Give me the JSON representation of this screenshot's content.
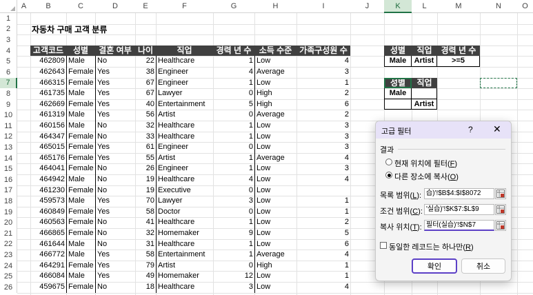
{
  "columns": [
    "A",
    "B",
    "C",
    "D",
    "E",
    "F",
    "G",
    "H",
    "I",
    "J",
    "K",
    "L",
    "M",
    "N",
    "O"
  ],
  "rows": [
    "1",
    "2",
    "3",
    "4",
    "5",
    "6",
    "7",
    "8",
    "9",
    "10",
    "11",
    "12",
    "13",
    "14",
    "15",
    "16",
    "17",
    "18",
    "19",
    "20",
    "21",
    "22",
    "23",
    "24",
    "25",
    "26"
  ],
  "title": "자동차 구매 고객 분류",
  "table": {
    "headers": [
      "고객코드",
      "성별",
      "결혼 여부",
      "나이",
      "직업",
      "경력 년 수",
      "소득 수준",
      "가족구성원 수"
    ],
    "rows": [
      [
        "462809",
        "Male",
        "No",
        "22",
        "Healthcare",
        "1",
        "Low",
        "4"
      ],
      [
        "462643",
        "Female",
        "Yes",
        "38",
        "Engineer",
        "4",
        "Average",
        "3"
      ],
      [
        "466315",
        "Female",
        "Yes",
        "67",
        "Engineer",
        "1",
        "Low",
        "1"
      ],
      [
        "461735",
        "Male",
        "Yes",
        "67",
        "Lawyer",
        "0",
        "High",
        "2"
      ],
      [
        "462669",
        "Female",
        "Yes",
        "40",
        "Entertainment",
        "5",
        "High",
        "6"
      ],
      [
        "461319",
        "Male",
        "Yes",
        "56",
        "Artist",
        "0",
        "Average",
        "2"
      ],
      [
        "460156",
        "Male",
        "No",
        "32",
        "Healthcare",
        "1",
        "Low",
        "3"
      ],
      [
        "464347",
        "Female",
        "No",
        "33",
        "Healthcare",
        "1",
        "Low",
        "3"
      ],
      [
        "465015",
        "Female",
        "Yes",
        "61",
        "Engineer",
        "0",
        "Low",
        "3"
      ],
      [
        "465176",
        "Female",
        "Yes",
        "55",
        "Artist",
        "1",
        "Average",
        "4"
      ],
      [
        "464041",
        "Female",
        "No",
        "26",
        "Engineer",
        "1",
        "Low",
        "3"
      ],
      [
        "464942",
        "Male",
        "No",
        "19",
        "Healthcare",
        "4",
        "Low",
        "4"
      ],
      [
        "461230",
        "Female",
        "No",
        "19",
        "Executive",
        "0",
        "Low",
        ""
      ],
      [
        "459573",
        "Male",
        "Yes",
        "70",
        "Lawyer",
        "3",
        "Low",
        "1"
      ],
      [
        "460849",
        "Female",
        "Yes",
        "58",
        "Doctor",
        "0",
        "Low",
        "1"
      ],
      [
        "460563",
        "Female",
        "No",
        "41",
        "Healthcare",
        "1",
        "Low",
        "2"
      ],
      [
        "466865",
        "Female",
        "No",
        "32",
        "Homemaker",
        "9",
        "Low",
        "5"
      ],
      [
        "461644",
        "Male",
        "No",
        "31",
        "Healthcare",
        "1",
        "Low",
        "6"
      ],
      [
        "466772",
        "Male",
        "Yes",
        "58",
        "Entertainment",
        "1",
        "Average",
        "4"
      ],
      [
        "464291",
        "Female",
        "Yes",
        "79",
        "Artist",
        "0",
        "High",
        "1"
      ],
      [
        "466084",
        "Male",
        "Yes",
        "49",
        "Homemaker",
        "12",
        "Low",
        "1"
      ],
      [
        "459675",
        "Female",
        "No",
        "18",
        "Healthcare",
        "3",
        "Low",
        "4"
      ]
    ]
  },
  "criteria1": {
    "headers": [
      "성별",
      "직업",
      "경력 년 수"
    ],
    "values": [
      "Male",
      "Artist",
      ">=5"
    ]
  },
  "criteria2": {
    "headers": [
      "성별",
      "직업"
    ],
    "row1": "Male",
    "row2": "Artist"
  },
  "dialog": {
    "title": "고급 필터",
    "help": "?",
    "close": "✕",
    "group_label": "결과",
    "radio1": "현재 위치에 필터",
    "radio1_key": "F",
    "radio2": "다른 장소에 복사",
    "radio2_key": "O",
    "list_label": "목록 범위",
    "list_key": "L",
    "list_value": "습)'!$B$4:$I$8072",
    "criteria_label": "조건 범위",
    "criteria_key": "C",
    "criteria_value": "'실습)'!$K$7:$L$9",
    "copy_label": "복사 위치",
    "copy_key": "T",
    "copy_value": "필터(실습)'!$N$7",
    "unique_label": "동일한 레코드는 하나만",
    "unique_key": "R",
    "ok": "확인",
    "cancel": "취소"
  },
  "colors": {
    "header_fill": "#404040",
    "selection_green": "#217346",
    "dialog_accent": "#5b3fc6"
  }
}
